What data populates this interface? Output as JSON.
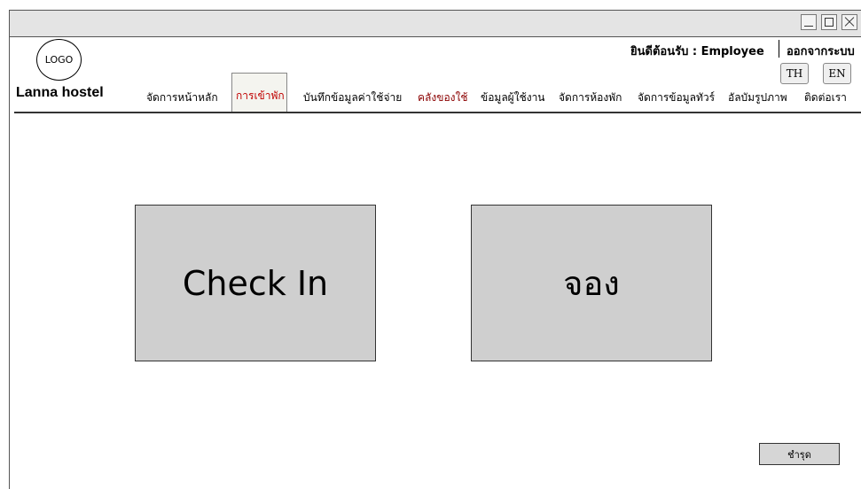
{
  "window": {
    "controls": [
      "minimize",
      "maximize",
      "close"
    ]
  },
  "header": {
    "logo_text": "LOGO",
    "brand": "Lanna hostel",
    "welcome": "ยินดีต้อนรับ : Employee",
    "logout": "ออกจากระบบ",
    "lang_th": "TH",
    "lang_en": "EN"
  },
  "nav": {
    "items": [
      {
        "label": "จัดการหน้าหลัก"
      },
      {
        "label": "การเข้าพัก"
      },
      {
        "label": "บันทึกข้อมูลค่าใช้จ่าย"
      },
      {
        "label": "คลังของใช้"
      },
      {
        "label": "ข้อมูลผู้ใช้งาน"
      },
      {
        "label": "จัดการห้องพัก"
      },
      {
        "label": "จัดการข้อมูลทัวร์"
      },
      {
        "label": "อัลบัมรูปภาพ"
      },
      {
        "label": "ติดต่อเรา"
      }
    ],
    "active_index": 1
  },
  "main": {
    "checkin_label": "Check In",
    "booking_label": "จอง",
    "repair_label": "ชำรุด"
  },
  "colors": {
    "active_tab_text": "#c00000",
    "inventory_text": "#8b0000",
    "button_bg": "#cfcfcf"
  }
}
